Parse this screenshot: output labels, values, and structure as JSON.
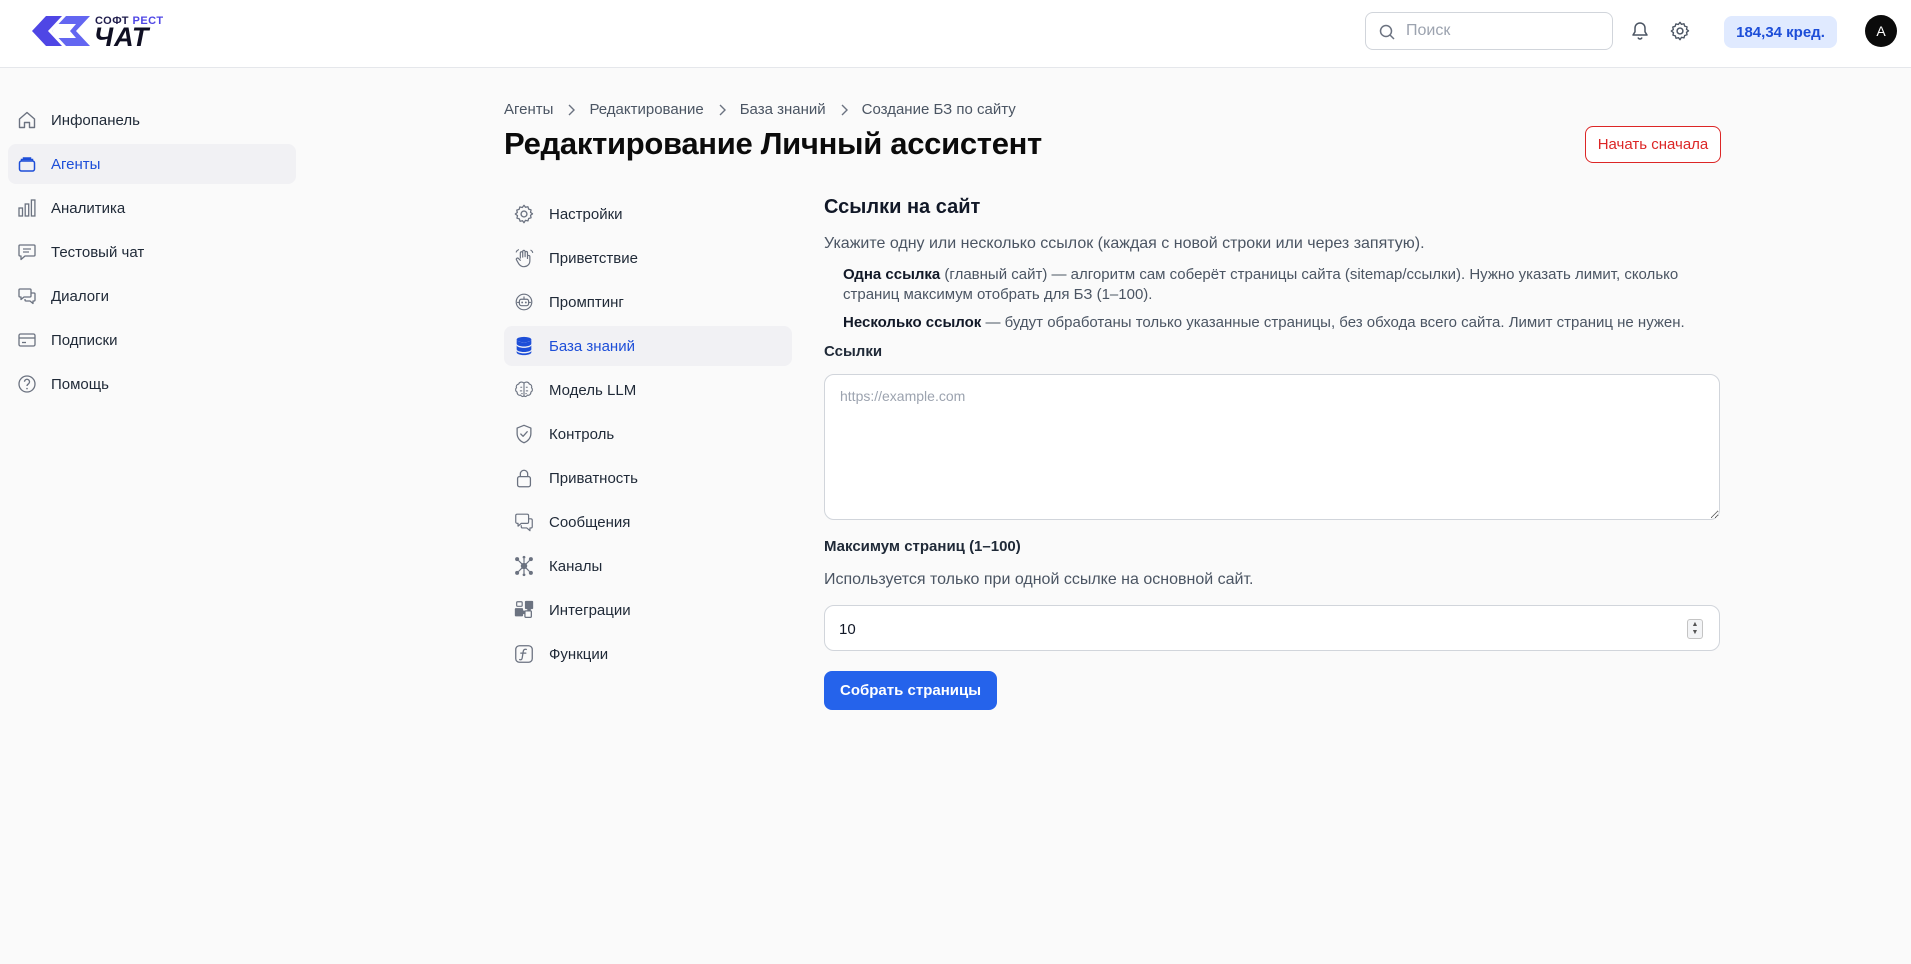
{
  "header": {
    "logo_small_left": "СОФТ",
    "logo_small_right": "РЕСТ",
    "logo_big": "ЧАТ",
    "search_placeholder": "Поиск",
    "credits": "184,34 кред.",
    "avatar_initial": "A"
  },
  "sidebar": {
    "items": [
      {
        "label": "Инфопанель",
        "icon": "home-icon"
      },
      {
        "label": "Агенты",
        "icon": "layers-icon",
        "active": true
      },
      {
        "label": "Аналитика",
        "icon": "bar-chart-icon"
      },
      {
        "label": "Тестовый чат",
        "icon": "chat-icon"
      },
      {
        "label": "Диалоги",
        "icon": "dialogs-icon"
      },
      {
        "label": "Подписки",
        "icon": "credit-card-icon"
      },
      {
        "label": "Помощь",
        "icon": "help-icon"
      }
    ]
  },
  "breadcrumb": [
    "Агенты",
    "Редактирование",
    "База знаний",
    "Создание БЗ по сайту"
  ],
  "page": {
    "title": "Редактирование Личный ассистент",
    "restart_label": "Начать сначала"
  },
  "subnav": {
    "items": [
      {
        "label": "Настройки",
        "icon": "gear-icon"
      },
      {
        "label": "Приветствие",
        "icon": "wave-hand-icon"
      },
      {
        "label": "Промптинг",
        "icon": "robot-icon"
      },
      {
        "label": "База знаний",
        "icon": "database-icon",
        "active": true
      },
      {
        "label": "Модель LLM",
        "icon": "brain-icon"
      },
      {
        "label": "Контроль",
        "icon": "shield-check-icon"
      },
      {
        "label": "Приватность",
        "icon": "lock-icon"
      },
      {
        "label": "Сообщения",
        "icon": "messages-icon"
      },
      {
        "label": "Каналы",
        "icon": "network-icon"
      },
      {
        "label": "Интеграции",
        "icon": "puzzle-icon"
      },
      {
        "label": "Функции",
        "icon": "function-icon"
      }
    ]
  },
  "form": {
    "section_title": "Ссылки на сайт",
    "section_desc": "Укажите одну или несколько ссылок (каждая с новой строки или через запятую).",
    "bullet1_bold": "Одна ссылка",
    "bullet1_text": " (главный сайт) — алгоритм сам соберёт страницы сайта (sitemap/ссылки). Нужно указать лимит, сколько страниц максимум отобрать для БЗ (1–100).",
    "bullet2_bold": "Несколько ссылок",
    "bullet2_text": " — будут обработаны только указанные страницы, без обхода всего сайта. Лимит страниц не нужен.",
    "links_label": "Ссылки",
    "links_placeholder": "https://example.com",
    "max_label": "Максимум страниц (1–100)",
    "max_desc": "Используется только при одной ссылке на основной сайт.",
    "max_value": "10",
    "collect_label": "Собрать страницы"
  },
  "colors": {
    "accent": "#2563eb",
    "danger": "#dc2626",
    "active_text": "#1d4ed8"
  }
}
